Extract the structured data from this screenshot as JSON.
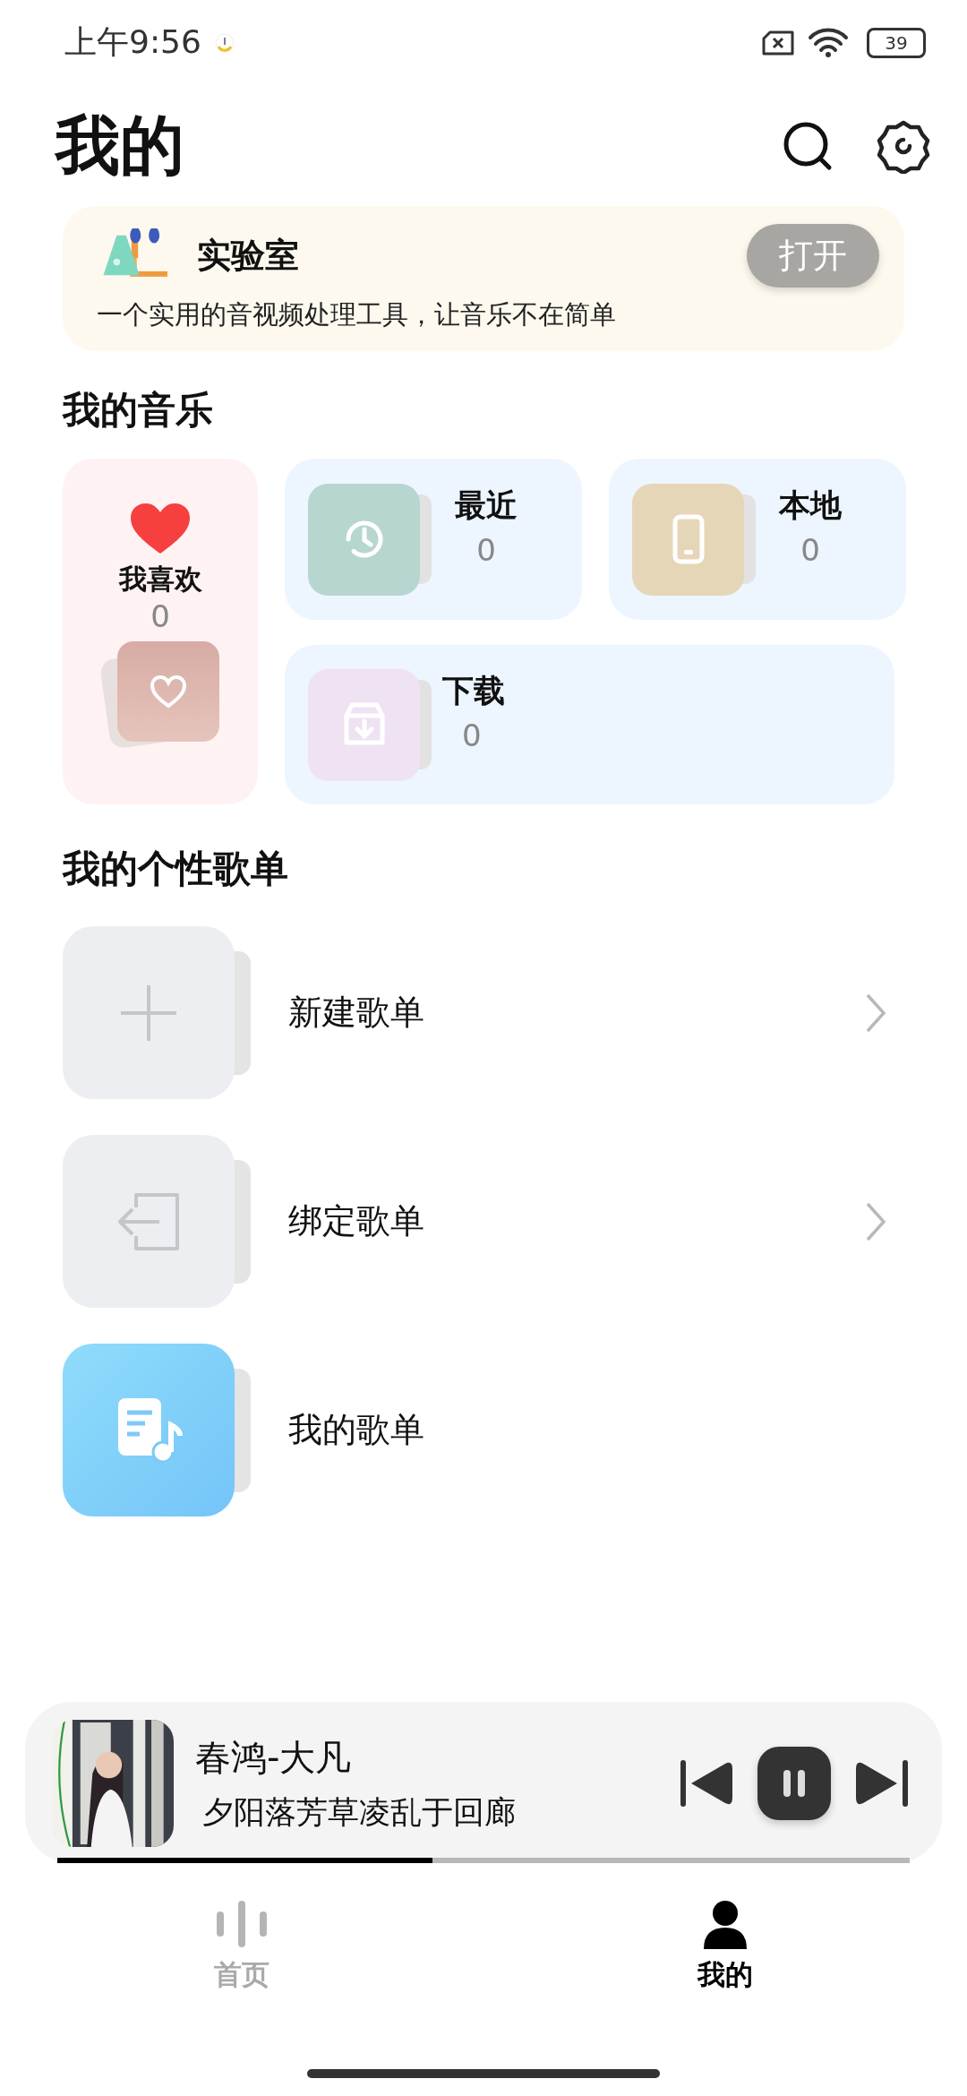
{
  "status_bar": {
    "time": "上午9:56",
    "battery": "39"
  },
  "header": {
    "title": "我的"
  },
  "banner": {
    "title": "实验室",
    "description": "一个实用的音视频处理工具，让音乐不在简单",
    "button": "打开"
  },
  "my_music": {
    "title": "我的音乐",
    "favorites": {
      "label": "我喜欢",
      "count": "0"
    },
    "cards": [
      {
        "kind": "recent",
        "label": "最近",
        "count": "0",
        "color": "#b7d6cf"
      },
      {
        "kind": "local",
        "label": "本地",
        "count": "0",
        "color": "#e6d6b8"
      },
      {
        "kind": "download",
        "label": "下载",
        "count": "0",
        "color": "#efe2f2"
      }
    ]
  },
  "playlists": {
    "title": "我的个性歌单",
    "items": [
      {
        "kind": "create",
        "label": "新建歌单",
        "chevron": true
      },
      {
        "kind": "bind",
        "label": "绑定歌单",
        "chevron": true
      },
      {
        "kind": "mine",
        "label": "我的歌单",
        "chevron": false
      }
    ]
  },
  "player": {
    "title": "春鸿-大凡",
    "lyric": "夕阳落芳草凌乱于回廊",
    "playing": true,
    "level": 0.44
  },
  "tabs": [
    {
      "label": "首页",
      "selected": false
    },
    {
      "label": "我的",
      "selected": true
    }
  ]
}
